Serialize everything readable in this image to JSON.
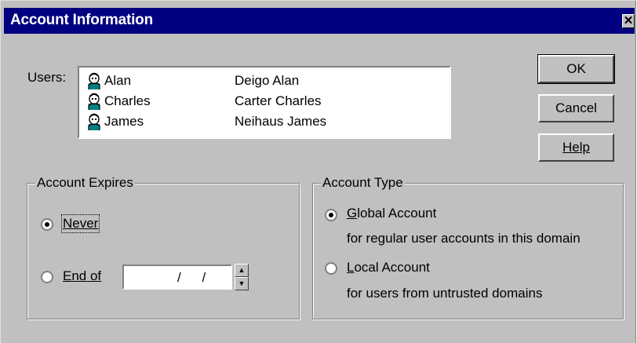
{
  "window": {
    "title": "Account Information",
    "close_glyph": "✕"
  },
  "users": {
    "label": "Users:",
    "items": [
      {
        "name": "Alan",
        "full_name": "Deigo Alan",
        "icon": "user-icon"
      },
      {
        "name": "Charles",
        "full_name": "Carter Charles",
        "icon": "user-icon"
      },
      {
        "name": "James",
        "full_name": "Neihaus James",
        "icon": "user-icon"
      }
    ]
  },
  "buttons": {
    "ok": "OK",
    "cancel": "Cancel",
    "help": "Help"
  },
  "account_expires": {
    "legend": "Account Expires",
    "never_label": "Never",
    "end_of_label": "End of",
    "date_value": "/ /",
    "selected": "never"
  },
  "account_type": {
    "legend": "Account Type",
    "global_label": "Global Account",
    "global_desc": "for regular user accounts in this domain",
    "local_label": "Local Account",
    "local_desc": "for users from untrusted domains",
    "selected": "global"
  },
  "colors": {
    "titlebar": "#000080",
    "face": "#c0c0c0",
    "icon_teal": "#008080"
  }
}
